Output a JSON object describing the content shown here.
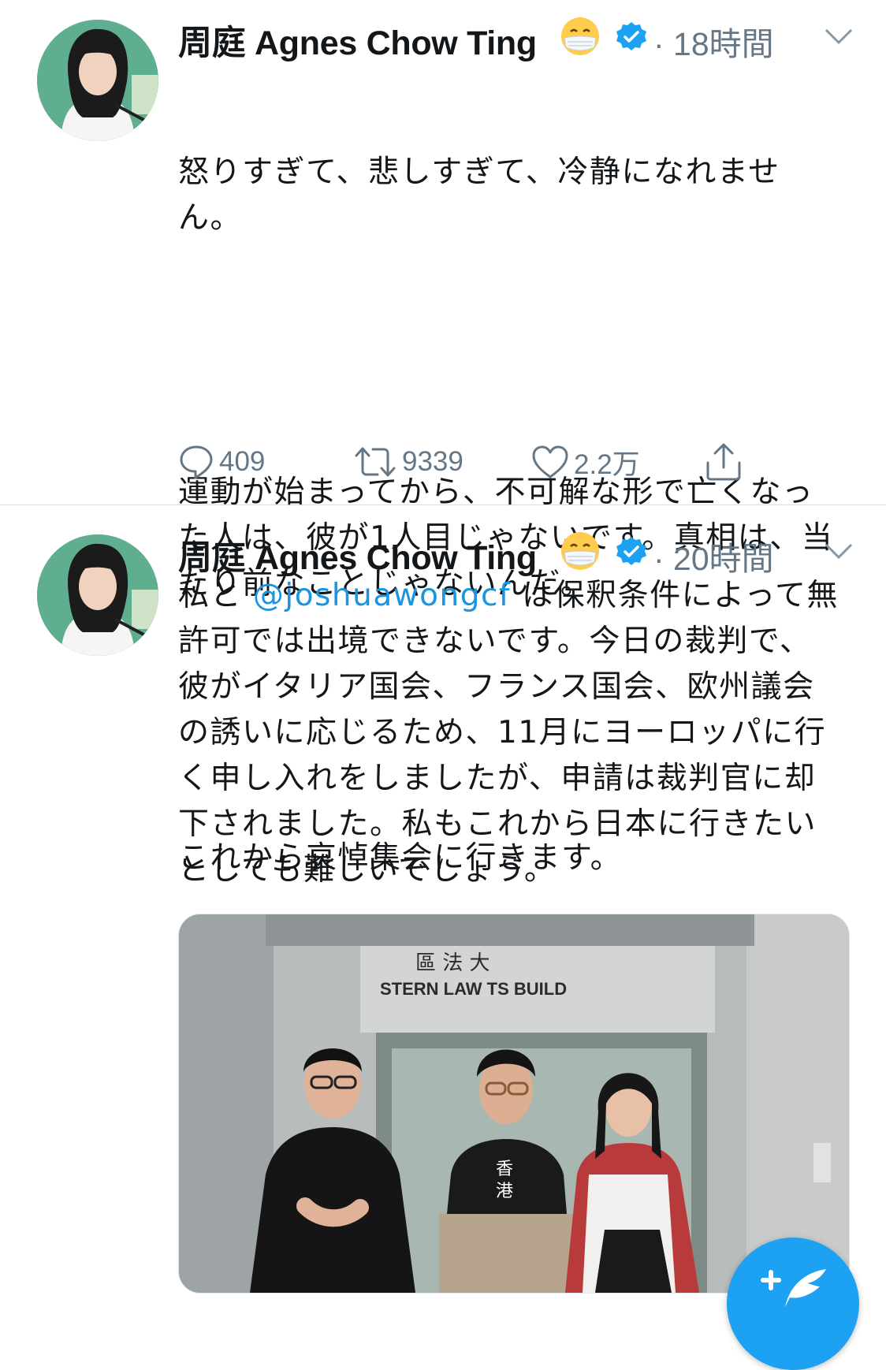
{
  "tweets": [
    {
      "author_name": "周庭 Agnes Chow Ting",
      "author_emoji": "face-with-medical-mask",
      "verified": true,
      "time": "· 18時間",
      "text_paragraphs": [
        "怒りすぎて、悲しすぎて、冷静になれません。",
        "運動が始まってから、不可解な形で亡くなった人は、彼が1人目じゃないです。真相は、当たり前なことじゃないんだ。",
        "これから哀悼集会に行きます。"
      ],
      "replies": "409",
      "retweets": "9339",
      "likes": "2.2万",
      "icons": [
        "reply-icon",
        "retweet-icon",
        "like-icon",
        "share-icon"
      ]
    },
    {
      "author_name": "周庭 Agnes Chow Ting",
      "author_emoji": "face-with-medical-mask",
      "verified": true,
      "time": "· 20時間",
      "text_before_mention": "私と ",
      "mention": "@joshuawongcf",
      "text_after_mention": " は保釈条件によって無許可では出境できないです。今日の裁判で、彼がイタリア国会、フランス国会、欧州議会の誘いに応じるため、11月にヨーロッパに行く申し入れをしましたが、申請は裁判官に却下されました。私もこれから日本に行きたいとしても難しいでしょう。",
      "media": {
        "sign_line1": "區 法 大",
        "sign_line2": "STERN  LAW  TS  BUILD"
      }
    }
  ],
  "colors": {
    "primary_text": "#14171a",
    "secondary_text": "#657786",
    "link": "#1b95e0",
    "brand_blue": "#1da1f2"
  },
  "fab": {
    "icon": "compose-icon"
  }
}
